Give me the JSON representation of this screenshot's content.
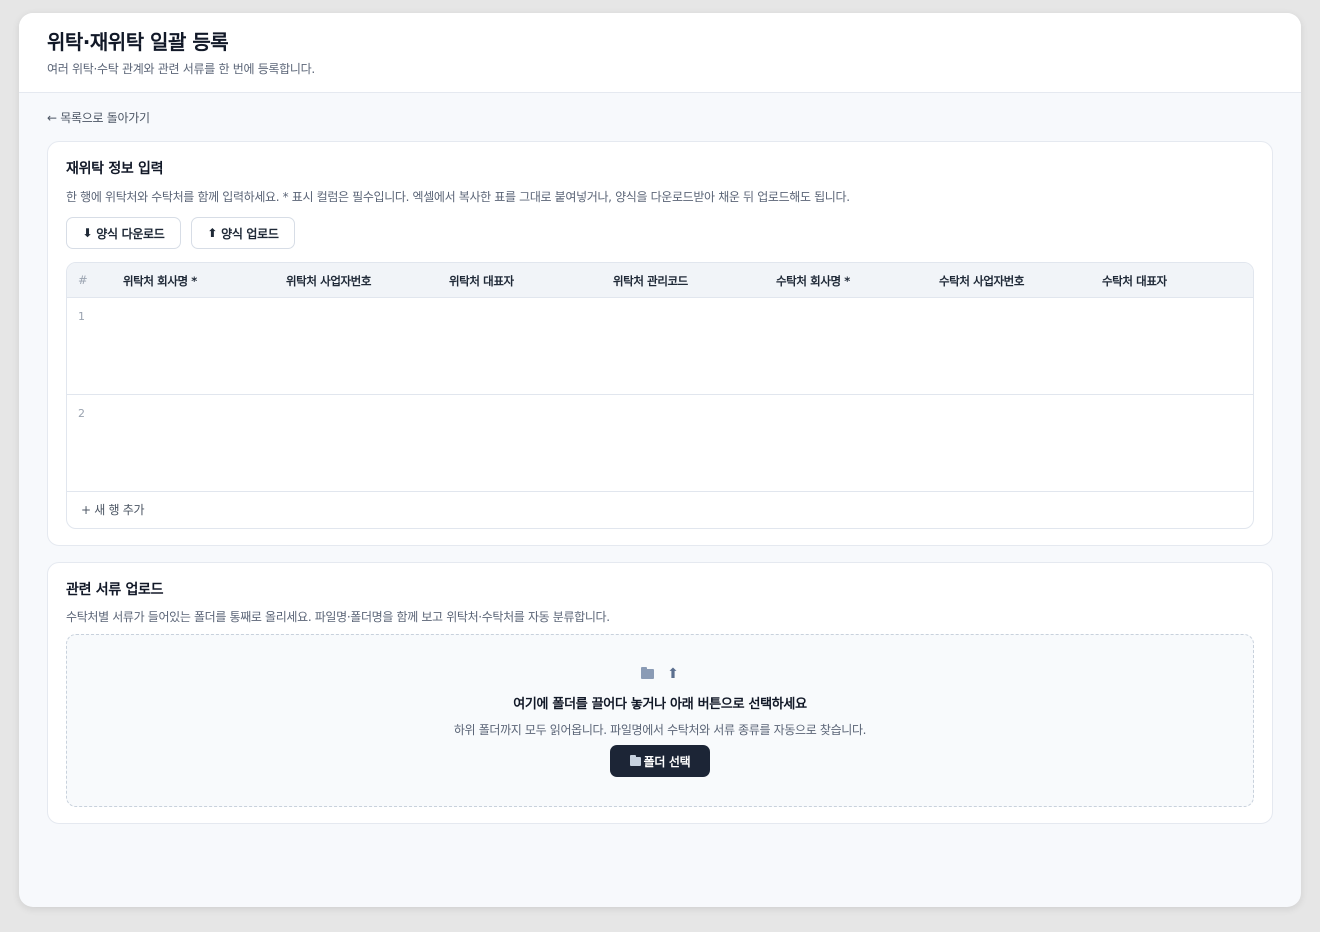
{
  "header": {
    "title": "위탁·재위탁 일괄 등록",
    "subtitle": "여러 위탁·수탁 관계와 관련 서류를 한 번에 등록합니다."
  },
  "nav": {
    "back_label": "← 목록으로 돌아가기"
  },
  "subcontract_section": {
    "title": "재위탁 정보 입력",
    "description": "한 행에 위탁처와 수탁처를 함께 입력하세요. * 표시 컬럼은 필수입니다. 엑셀에서 복사한 표를 그대로 붙여넣거나, 양식을 다운로드받아 채운 뒤 업로드해도 됩니다.",
    "download_button": {
      "icon": "⬇",
      "label": "양식 다운로드"
    },
    "upload_button": {
      "icon": "⬆",
      "label": "양식 업로드"
    },
    "table": {
      "columns": [
        "#",
        "위탁처 회사명 *",
        "위탁처 사업자번호",
        "위탁처 대표자",
        "위탁처 관리코드",
        "수탁처 회사명 *",
        "수탁처 사업자번호",
        "수탁처 대표자"
      ],
      "rows": [
        "1",
        "2"
      ],
      "add_row_label": "+ 새 행 추가"
    }
  },
  "documents_section": {
    "title": "관련 서류 업로드",
    "description": "수탁처별 서류가 들어있는 폴더를 통째로 올리세요. 파일명·폴더명을 함께 보고 위탁처·수탁처를 자동 분류합니다.",
    "dropzone": {
      "icons": [
        "folder-icon",
        "arrow-up-icon"
      ],
      "title": "여기에 폴더를 끌어다 놓거나 아래 버튼으로 선택하세요",
      "description": "하위 폴더까지 모두 읽어옵니다. 파일명에서 수탁처와 서류 종류를 자동으로 찾습니다.",
      "button_label": "폴더 선택"
    }
  },
  "colors": {
    "background": "#f7f9fc",
    "card": "#ffffff",
    "primary_button": "#1c2536",
    "border": "#e5e9f0"
  }
}
